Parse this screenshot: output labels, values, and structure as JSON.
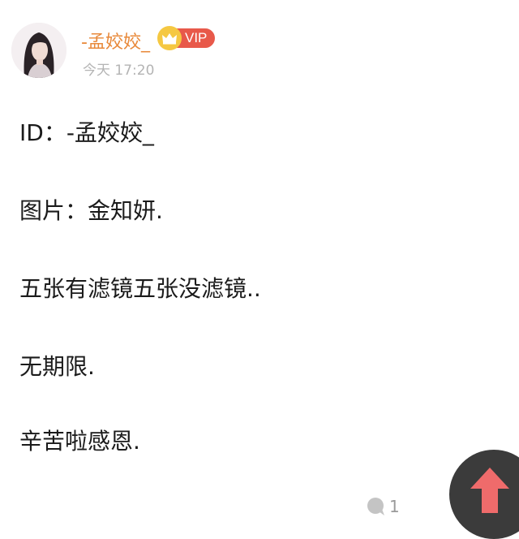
{
  "post": {
    "author": {
      "username": "-孟姣姣_",
      "badge_label": "VIP",
      "time": "今天 17:20"
    },
    "lines": [
      "ID：-孟姣姣_",
      "图片：金知妍.",
      "五张有滤镜五张没滤镜..",
      "无期限.",
      "辛苦啦感恩."
    ],
    "comment_count": "1"
  },
  "icons": {
    "avatar": "user-avatar-photo",
    "crown": "crown-icon",
    "comment": "comment-bubble-icon",
    "scroll_top": "up-arrow-icon"
  },
  "colors": {
    "username": "#e8893a",
    "vip_badge": "#e8594a",
    "crown": "#f5c842",
    "scroll_button": "#3b3b3b",
    "up_arrow": "#ef6b6b"
  }
}
